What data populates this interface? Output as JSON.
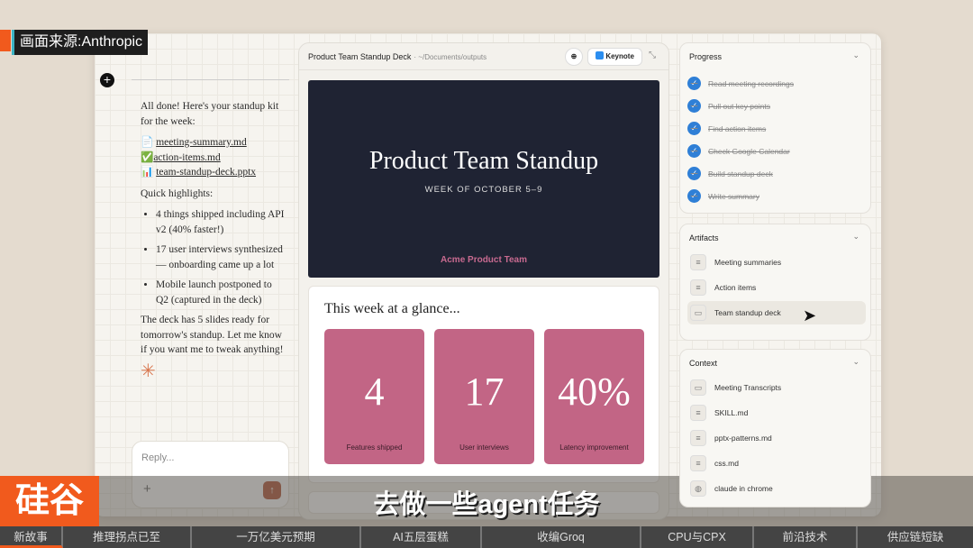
{
  "source_banner": "画面来源:Anthropic",
  "chat": {
    "intro": "All done! Here's your standup kit for the week:",
    "files": [
      {
        "icon": "file-icon",
        "glyph": "📄",
        "name": "meeting-summary.md"
      },
      {
        "icon": "check-icon",
        "glyph": "✅",
        "name": "action-items.md"
      },
      {
        "icon": "chart-icon",
        "glyph": "📊",
        "name": "team-standup-deck.pptx"
      }
    ],
    "highlights_title": "Quick highlights:",
    "highlights": [
      "4 things shipped including API v2 (40% faster!)",
      "17 user interviews synthesized — onboarding came up a lot",
      "Mobile launch postponed to Q2 (captured in the deck)"
    ],
    "outro": "The deck has 5 slides ready for tomorrow's standup. Let me know if you want me to tweak anything!",
    "reply_placeholder": "Reply..."
  },
  "preview": {
    "title": "Product Team Standup Deck",
    "path": "· ~/Documents/outputs",
    "open_in": "Keynote",
    "slide1": {
      "title": "Product Team Standup",
      "subtitle": "WEEK OF OCTOBER 5–9",
      "team": "Acme Product Team"
    },
    "slide2": {
      "title": "This week at a glance...",
      "stats": [
        {
          "value": "4",
          "label": "Features shipped"
        },
        {
          "value": "17",
          "label": "User interviews"
        },
        {
          "value": "40%",
          "label": "Latency improvement"
        }
      ]
    }
  },
  "progress": {
    "title": "Progress",
    "items": [
      "Read meeting recordings",
      "Pull out key points",
      "Find action items",
      "Check Google Calendar",
      "Build standup deck",
      "Write summary"
    ]
  },
  "artifacts": {
    "title": "Artifacts",
    "items": [
      "Meeting summaries",
      "Action items",
      "Team standup deck"
    ]
  },
  "context": {
    "title": "Context",
    "items": [
      "Meeting Transcripts",
      "SKILL.md",
      "pptx-patterns.md",
      "css.md",
      "claude in chrome"
    ]
  },
  "subtitle": "去做一些agent任务",
  "logo": "硅谷",
  "ticker": [
    "新故事",
    "推理拐点已至",
    "一万亿美元预期",
    "AI五层蛋糕",
    "收编Groq",
    "CPU与CPX",
    "前沿技术",
    "供应链短缺"
  ],
  "colors": {
    "accent": "#2f7fd6",
    "slide_bg": "#1f2333",
    "stat_card": "#c26585",
    "brand": "#f15a1d"
  }
}
